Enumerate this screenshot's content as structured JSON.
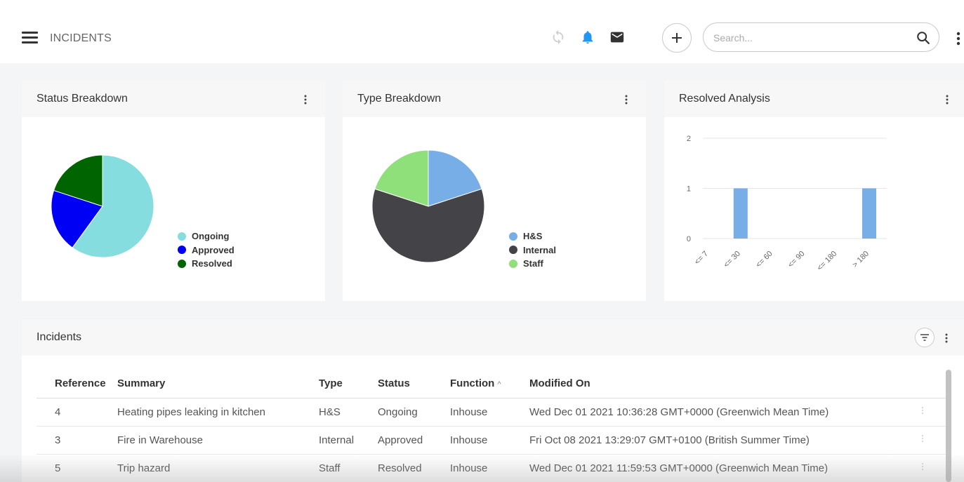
{
  "header": {
    "title": "INCIDENTS",
    "search_placeholder": "Search...",
    "icons": [
      "menu-icon",
      "sync-icon",
      "bell-icon",
      "mail-icon",
      "plus-icon",
      "search-icon",
      "more-vert-icon"
    ],
    "accent_color": "#2196f3"
  },
  "status_card": {
    "title": "Status Breakdown",
    "chart_data": {
      "type": "pie",
      "categories": [
        "Ongoing",
        "Approved",
        "Resolved"
      ],
      "values": [
        3,
        1,
        1
      ],
      "colors": [
        "#86dde0",
        "#0000f5",
        "#006400"
      ],
      "legend": "right"
    }
  },
  "type_card": {
    "title": "Type Breakdown",
    "chart_data": {
      "type": "pie",
      "categories": [
        "H&S",
        "Internal",
        "Staff"
      ],
      "values": [
        1,
        3,
        1
      ],
      "colors": [
        "#78aee8",
        "#434348",
        "#8fe07b"
      ],
      "legend": "right"
    }
  },
  "resolved_card": {
    "title": "Resolved Analysis",
    "chart_data": {
      "type": "bar",
      "categories": [
        "<= 7",
        "<= 30",
        "<= 60",
        "<= 90",
        "<= 180",
        "> 180"
      ],
      "values": [
        0,
        1,
        0,
        0,
        0,
        1
      ],
      "ylim": [
        0,
        2
      ],
      "yticks": [
        "0",
        "1",
        "2"
      ],
      "color": "#78aee8",
      "grid": true
    }
  },
  "incidents": {
    "title": "Incidents",
    "columns": [
      "Reference",
      "Summary",
      "Type",
      "Status",
      "Function",
      "Modified On"
    ],
    "sort_indicator": "^",
    "rows": [
      {
        "reference": "4",
        "summary": "Heating pipes leaking in kitchen",
        "type": "H&S",
        "status": "Ongoing",
        "function": "Inhouse",
        "modified": "Wed Dec 01 2021 10:36:28 GMT+0000 (Greenwich Mean Time)"
      },
      {
        "reference": "3",
        "summary": "Fire in Warehouse",
        "type": "Internal",
        "status": "Approved",
        "function": "Inhouse",
        "modified": "Fri Oct 08 2021 13:29:07 GMT+0100 (British Summer Time)"
      },
      {
        "reference": "5",
        "summary": "Trip hazard",
        "type": "Staff",
        "status": "Resolved",
        "function": "Inhouse",
        "modified": "Wed Dec 01 2021 11:59:53 GMT+0000 (Greenwich Mean Time)"
      }
    ]
  }
}
